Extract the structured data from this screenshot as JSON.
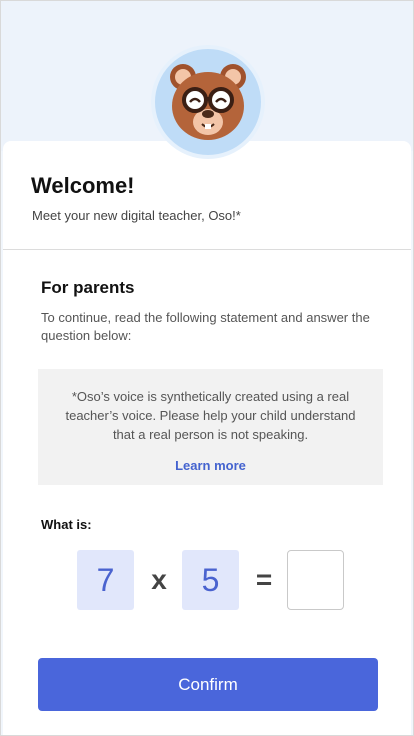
{
  "colors": {
    "accent": "#4a66db",
    "number_box_bg": "#e1e7fb",
    "number_text": "#4a63cf",
    "header_bg": "#edf3fb",
    "avatar_bg": "#bfdcf7"
  },
  "header": {
    "avatar_icon": "bear-with-glasses-icon"
  },
  "welcome": {
    "title": "Welcome!",
    "subtitle": "Meet your new digital teacher, Oso!*"
  },
  "parents": {
    "title": "For parents",
    "instructions": "To continue, read the following statement and answer the question below:",
    "notice": "*Oso’s voice is synthetically created using a real teacher’s voice. Please help your child understand that a real person is not speaking.",
    "learn_more": "Learn more"
  },
  "question": {
    "label": "What is:",
    "operand_a": "7",
    "operator": "x",
    "operand_b": "5",
    "equals": "=",
    "answer_value": "",
    "answer_placeholder": ""
  },
  "confirm_label": "Confirm"
}
